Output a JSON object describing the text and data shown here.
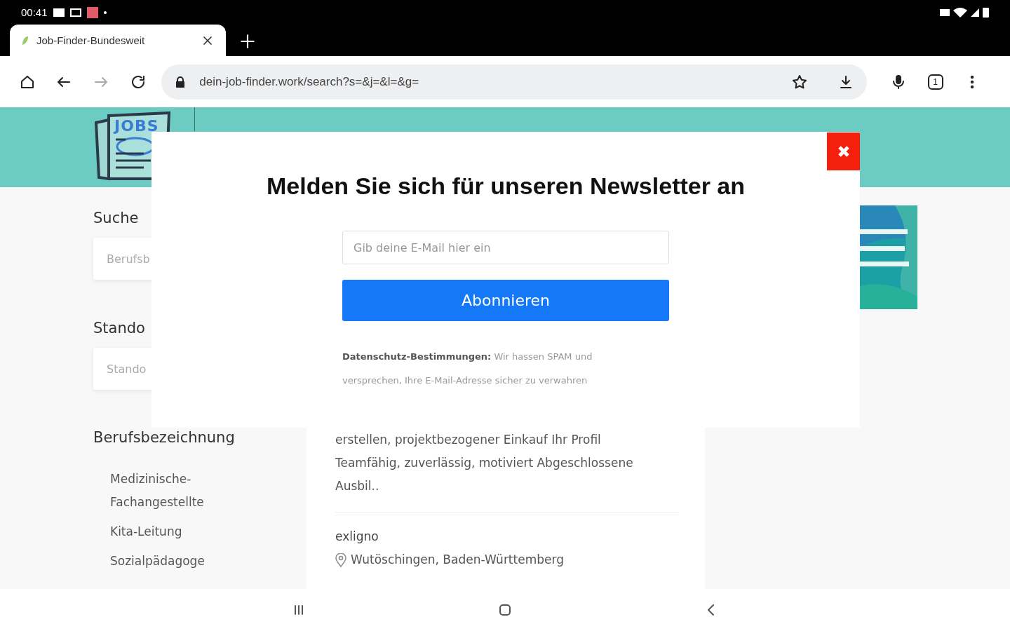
{
  "status_bar": {
    "time": "00:41"
  },
  "browser": {
    "tabs": [
      {
        "title": "Job-Finder-Bundesweit",
        "selected": true
      }
    ],
    "url": "dein-job-finder.work/search?s=&j=&l=&g=",
    "tab_count": "1"
  },
  "header": {
    "logo_text": "JOBS"
  },
  "sidebar": {
    "search_label": "Suche",
    "search_placeholder": "Berufsb",
    "location_label": "Stando",
    "location_placeholder": "Stando",
    "category_title": "Berufsbezeichnung",
    "categories": [
      "Medizinische-Fachangestellte",
      "Kita-Leitung",
      "Sozialpädagoge"
    ]
  },
  "job_card": {
    "snippet": "erstellen, projektbezogener Einkauf Ihr Profil Teamfähig, zuverlässig, motiviert Abgeschlossene Ausbil..",
    "company": "exligno",
    "location": "Wutöschingen, Baden-Württemberg"
  },
  "modal": {
    "title": "Melden Sie sich für unseren Newsletter an",
    "email_placeholder": "Gib deine E-Mail hier ein",
    "button": "Abonnieren",
    "privacy": "**Datenschutz-Bestimmungen:** Wir hassen SPAM und versprechen, Ihre E-Mail-Adresse sicher zu verwahren"
  }
}
